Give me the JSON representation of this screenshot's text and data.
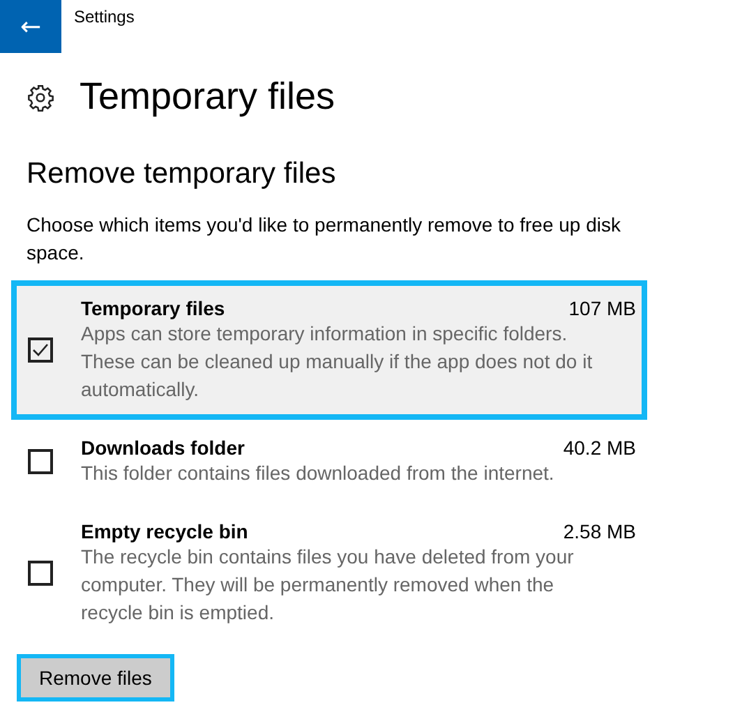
{
  "window": {
    "title": "Settings",
    "back": "←"
  },
  "page_title": "Temporary files",
  "section_title": "Remove temporary files",
  "description": "Choose which items you'd like to permanently remove to free up disk space.",
  "items": [
    {
      "name": "Temporary files",
      "size": "107 MB",
      "detail": "Apps can store temporary information in specific folders. These can be cleaned up manually if the app does not do it automatically.",
      "checked": true,
      "selected": true
    },
    {
      "name": "Downloads folder",
      "size": "40.2 MB",
      "detail": "This folder contains files downloaded from the internet.",
      "checked": false,
      "selected": false
    },
    {
      "name": "Empty recycle bin",
      "size": "2.58 MB",
      "detail": "The recycle bin contains files you have deleted from your computer. They will be permanently removed when the recycle bin is emptied.",
      "checked": false,
      "selected": false
    }
  ],
  "button": {
    "label": "Remove files",
    "focused": true
  }
}
